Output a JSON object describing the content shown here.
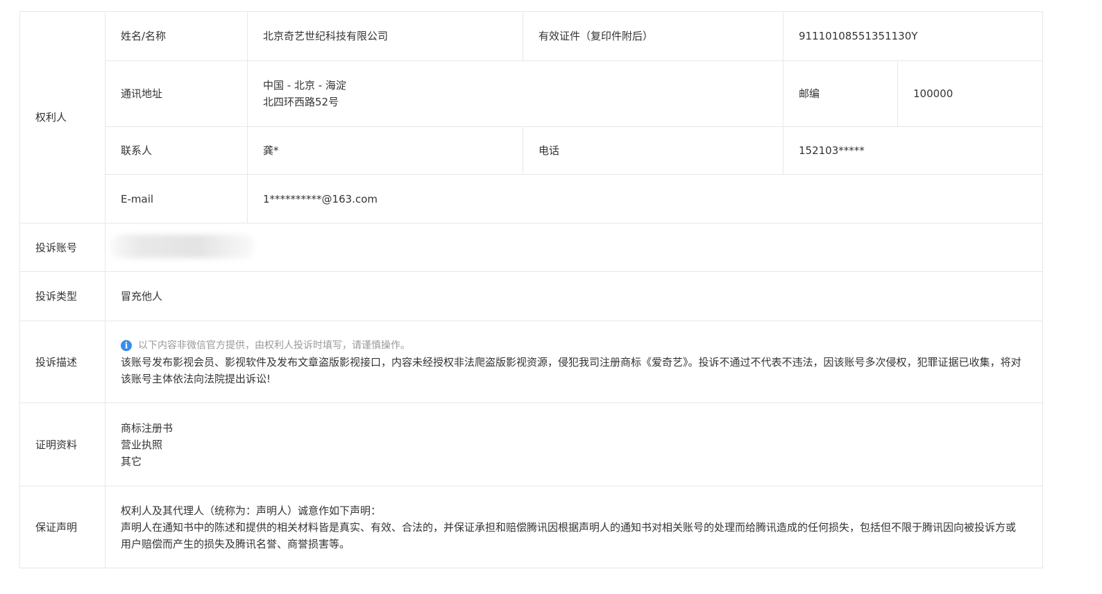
{
  "owner": {
    "section_label": "权利人",
    "name_label": "姓名/名称",
    "name_value": "北京奇艺世纪科技有限公司",
    "id_label": "有效证件（复印件附后）",
    "id_value": "91110108551351130Y",
    "address_label": "通讯地址",
    "address_line1": "中国 - 北京 - 海淀",
    "address_line2": "北四环西路52号",
    "zip_label": "邮编",
    "zip_value": "100000",
    "contact_label": "联系人",
    "contact_value": "龚*",
    "phone_label": "电话",
    "phone_value": "152103*****",
    "email_label": "E-mail",
    "email_value": "1**********@163.com"
  },
  "complaint": {
    "account_label": "投诉账号",
    "type_label": "投诉类型",
    "type_value": "冒充他人",
    "desc_label": "投诉描述",
    "desc_notice": "以下内容非微信官方提供，由权利人投诉时填写，请谨慎操作。",
    "desc_text": "该账号发布影视会员、影视软件及发布文章盗版影视接口，内容未经授权非法爬盗版影视资源，侵犯我司注册商标《爱奇艺》。投诉不通过不代表不违法，因该账号多次侵权，犯罪证据已收集，将对该账号主体依法向法院提出诉讼!"
  },
  "evidence": {
    "label": "证明资料",
    "items": [
      "商标注册书",
      "营业执照",
      "其它"
    ]
  },
  "guarantee": {
    "label": "保证声明",
    "line1": "权利人及其代理人（统称为：声明人）诚意作如下声明：",
    "text": "声明人在通知书中的陈述和提供的相关材料皆是真实、有效、合法的，并保证承担和赔偿腾讯因根据声明人的通知书对相关账号的处理而给腾讯造成的任何损失，包括但不限于腾讯因向被投诉方或用户赔偿而产生的损失及腾讯名誉、商誉损害等。"
  },
  "icons": {
    "info_icon": "i"
  },
  "colors": {
    "border": "#e7e7e7",
    "text": "#333333",
    "notice": "#999999",
    "info_icon": "#3a8ee6"
  }
}
